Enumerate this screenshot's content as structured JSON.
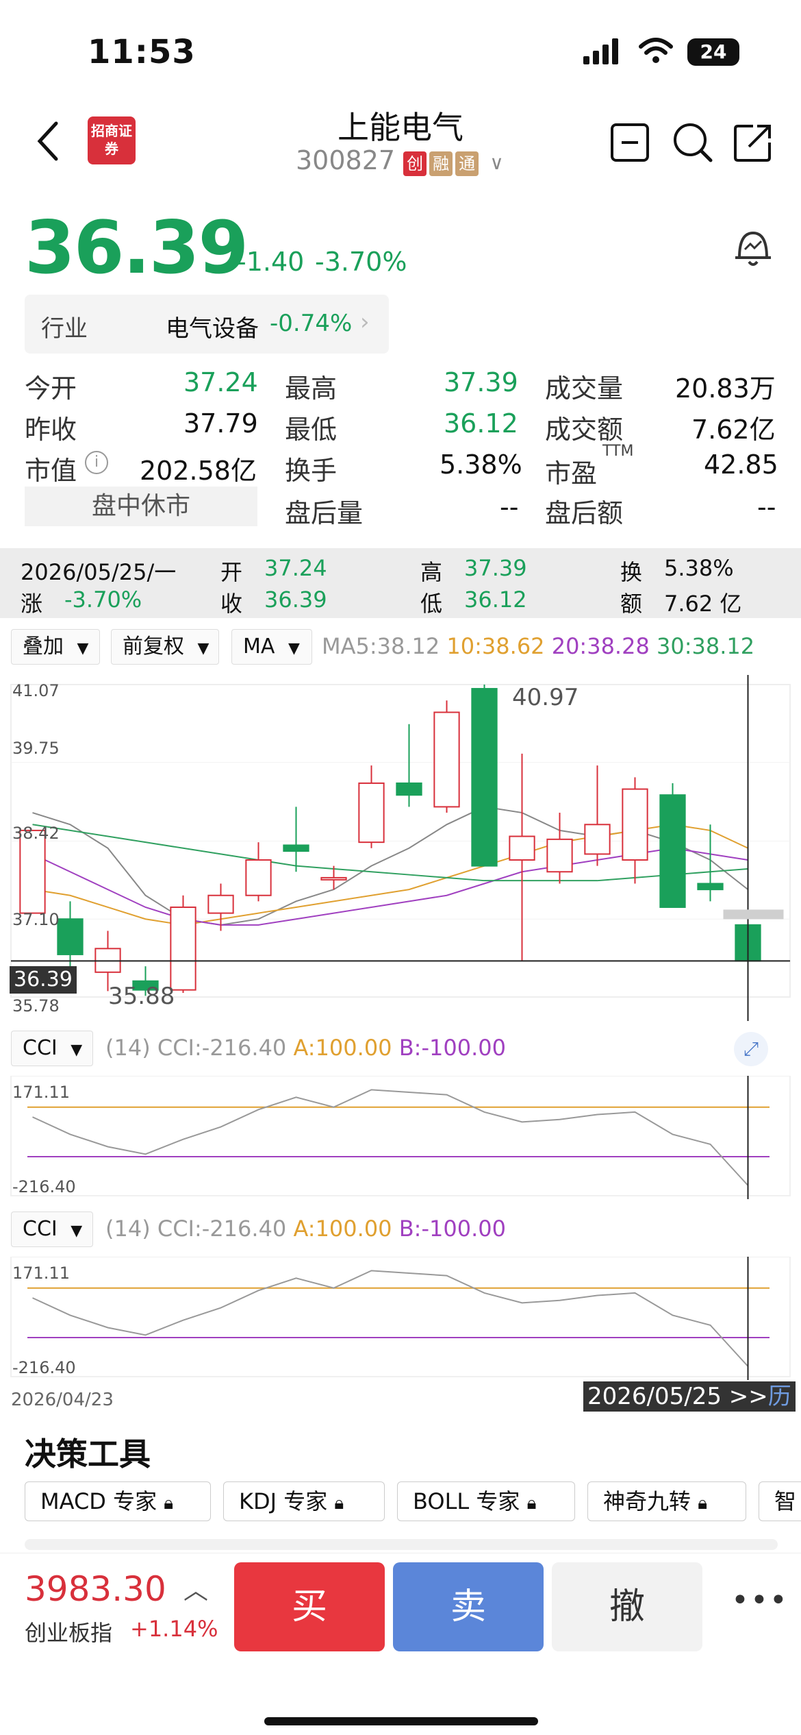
{
  "status_bar": {
    "time": "11:53",
    "battery": "24"
  },
  "header": {
    "title": "上能电气",
    "code": "300827",
    "tags": [
      "创",
      "融",
      "通"
    ],
    "logo_text": "招商证券"
  },
  "quote": {
    "price": "36.39",
    "change": "-1.40",
    "change_pct": "-3.70%",
    "industry_label": "行业",
    "industry_name": "电气设备",
    "industry_pct": "-0.74%"
  },
  "stats": {
    "open_label": "今开",
    "open": "37.24",
    "high_label": "最高",
    "high": "37.39",
    "volume_label": "成交量",
    "volume": "20.83万",
    "prev_label": "昨收",
    "prev": "37.79",
    "low_label": "最低",
    "low": "36.12",
    "amount_label": "成交额",
    "amount": "7.62亿",
    "mcap_label": "市值",
    "mcap": "202.58亿",
    "turnover_label": "换手",
    "turnover": "5.38%",
    "pe_label": "市盈",
    "pe_sup": "TTM",
    "pe": "42.85",
    "session": "盘中休市",
    "after_vol_label": "盘后量",
    "after_vol": "--",
    "after_amt_label": "盘后额",
    "after_amt": "--"
  },
  "ohlc_bar": {
    "date": "2026/05/25/一",
    "open_label": "开",
    "open": "37.24",
    "high_label": "高",
    "high": "37.39",
    "turnover_label": "换",
    "turnover": "5.38%",
    "chg_label": "涨",
    "chg": "-3.70%",
    "close_label": "收",
    "close": "36.39",
    "low_label": "低",
    "low": "36.12",
    "amount_label": "额",
    "amount": "7.62 亿"
  },
  "chart_controls": {
    "overlay": "叠加",
    "adjust": "前复权",
    "indicator": "MA",
    "ma5": "MA5:38.12",
    "ma10": "10:38.62",
    "ma20": "20:38.28",
    "ma30": "30:38.12"
  },
  "kline_labels": {
    "y_top": "41.07",
    "y_2": "39.75",
    "y_3": "38.42",
    "y_4": "37.10",
    "y_bottom": "35.78",
    "cur_price": "36.39",
    "max_label": "40.97",
    "min_label": "35.88"
  },
  "cci_panels": [
    {
      "sel": "CCI",
      "period": "(14)",
      "value": "CCI:-216.40",
      "a": "A:100.00",
      "b": "B:-100.00",
      "y_top": "171.11",
      "y_bottom": "-216.40"
    },
    {
      "sel": "CCI",
      "period": "(14)",
      "value": "CCI:-216.40",
      "a": "A:100.00",
      "b": "B:-100.00",
      "y_top": "171.11",
      "y_bottom": "-216.40"
    }
  ],
  "date_axis": {
    "start": "2026/04/23",
    "end": "2026/05/25 >>",
    "hist": "历"
  },
  "tools": {
    "title": "决策工具",
    "items": [
      "MACD 专家",
      "KDJ 专家",
      "BOLL 专家",
      "神奇九转",
      "智"
    ]
  },
  "bottom": {
    "index_value": "3983.30",
    "index_name": "创业板指",
    "index_pct": "+1.14%",
    "buy": "买",
    "sell": "卖",
    "cancel": "撤"
  },
  "colors": {
    "up": "#d8303b",
    "down": "#1aa05a",
    "ma5": "#888888",
    "ma10": "#e0a030",
    "ma20": "#a040c0",
    "ma30": "#30a060",
    "buy": "#e8373f",
    "sell": "#5b86d9"
  },
  "chart_data": {
    "type": "candlestick",
    "y_range": [
      35.78,
      41.07
    ],
    "candles": [
      {
        "o": 37.2,
        "c": 38.6,
        "h": 38.6,
        "l": 37.2
      },
      {
        "o": 37.1,
        "c": 36.5,
        "h": 37.4,
        "l": 36.3
      },
      {
        "o": 36.2,
        "c": 36.6,
        "h": 36.9,
        "l": 35.88
      },
      {
        "o": 36.05,
        "c": 35.9,
        "h": 36.3,
        "l": 35.8
      },
      {
        "o": 35.9,
        "c": 37.3,
        "h": 37.5,
        "l": 35.85
      },
      {
        "o": 37.2,
        "c": 37.5,
        "h": 37.7,
        "l": 36.9
      },
      {
        "o": 37.5,
        "c": 38.1,
        "h": 38.4,
        "l": 37.4
      },
      {
        "o": 38.35,
        "c": 38.25,
        "h": 39.0,
        "l": 37.9
      },
      {
        "o": 37.8,
        "c": 37.8,
        "h": 38.0,
        "l": 37.6
      },
      {
        "o": 38.4,
        "c": 39.4,
        "h": 39.7,
        "l": 38.3
      },
      {
        "o": 39.4,
        "c": 39.2,
        "h": 40.4,
        "l": 39.0
      },
      {
        "o": 39.0,
        "c": 40.6,
        "h": 40.8,
        "l": 38.9
      },
      {
        "o": 41.0,
        "c": 38.0,
        "h": 41.07,
        "l": 38.0
      },
      {
        "o": 38.1,
        "c": 38.5,
        "h": 39.9,
        "l": 36.4
      },
      {
        "o": 37.9,
        "c": 38.45,
        "h": 38.9,
        "l": 37.7
      },
      {
        "o": 38.2,
        "c": 38.7,
        "h": 39.7,
        "l": 38.0
      },
      {
        "o": 38.1,
        "c": 39.3,
        "h": 39.5,
        "l": 37.7
      },
      {
        "o": 39.2,
        "c": 37.3,
        "h": 39.4,
        "l": 37.3
      },
      {
        "o": 37.7,
        "c": 37.6,
        "h": 38.7,
        "l": 37.4
      },
      {
        "o": 37.0,
        "c": 36.39,
        "h": 37.1,
        "l": 36.39
      }
    ],
    "ma_series": [
      {
        "name": "MA5",
        "values": [
          38.9,
          38.7,
          38.3,
          37.5,
          37.1,
          37.0,
          37.1,
          37.4,
          37.6,
          38.0,
          38.3,
          38.7,
          39.0,
          38.9,
          38.6,
          38.5,
          38.6,
          38.4,
          38.1,
          37.6
        ]
      },
      {
        "name": "MA10",
        "values": [
          37.6,
          37.5,
          37.3,
          37.1,
          37.0,
          37.1,
          37.2,
          37.3,
          37.4,
          37.5,
          37.6,
          37.8,
          38.0,
          38.2,
          38.4,
          38.5,
          38.6,
          38.7,
          38.6,
          38.3
        ]
      },
      {
        "name": "MA20",
        "values": [
          38.2,
          37.9,
          37.6,
          37.3,
          37.1,
          37.0,
          37.0,
          37.1,
          37.2,
          37.3,
          37.4,
          37.5,
          37.7,
          37.9,
          38.0,
          38.1,
          38.2,
          38.3,
          38.2,
          38.1
        ]
      },
      {
        "name": "MA30",
        "values": [
          38.7,
          38.6,
          38.5,
          38.4,
          38.3,
          38.2,
          38.1,
          38.0,
          37.95,
          37.9,
          37.85,
          37.8,
          37.75,
          37.75,
          37.75,
          37.75,
          37.8,
          37.85,
          37.9,
          37.95
        ]
      }
    ],
    "cci": [
      60,
      -10,
      -60,
      -90,
      -30,
      20,
      90,
      140,
      100,
      170,
      160,
      150,
      80,
      40,
      50,
      70,
      80,
      -10,
      -50,
      -216.4
    ],
    "cci_range": [
      -216.4,
      171.11
    ]
  }
}
